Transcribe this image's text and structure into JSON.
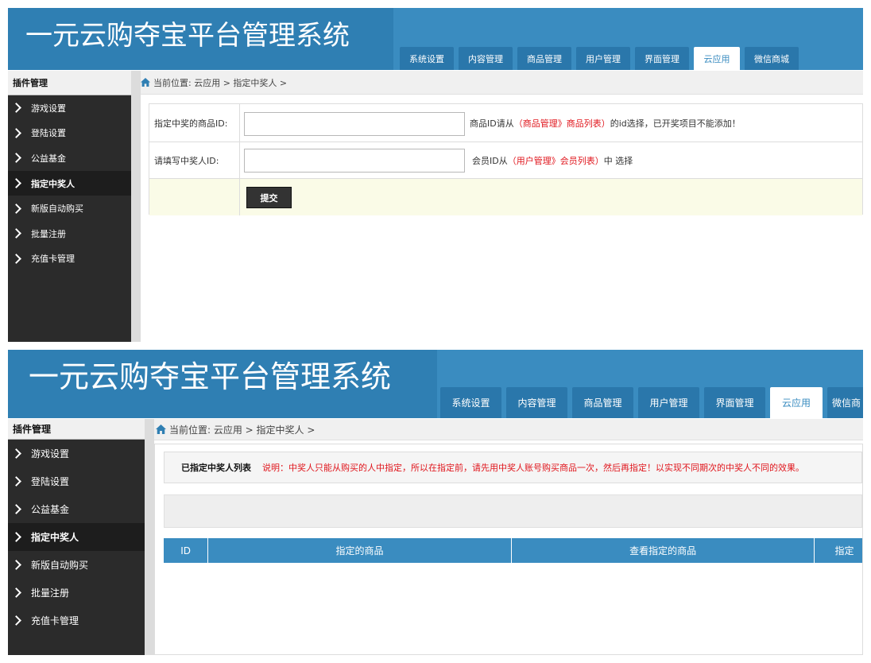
{
  "header": {
    "title": "一元云购夺宝平台管理系统",
    "tabs": [
      {
        "label": "系统设置",
        "active": false
      },
      {
        "label": "内容管理",
        "active": false
      },
      {
        "label": "商品管理",
        "active": false
      },
      {
        "label": "用户管理",
        "active": false
      },
      {
        "label": "界面管理",
        "active": false
      },
      {
        "label": "云应用",
        "active": true
      },
      {
        "label": "微信商城",
        "active": false
      }
    ],
    "tabs_clipped": [
      {
        "label": "系统设置",
        "active": false
      },
      {
        "label": "内容管理",
        "active": false
      },
      {
        "label": "商品管理",
        "active": false
      },
      {
        "label": "用户管理",
        "active": false
      },
      {
        "label": "界面管理",
        "active": false
      },
      {
        "label": "云应用",
        "active": true
      },
      {
        "label": "微信商",
        "active": false
      }
    ]
  },
  "sidebar": {
    "title": "插件管理",
    "items": [
      {
        "label": "游戏设置",
        "active": false
      },
      {
        "label": "登陆设置",
        "active": false
      },
      {
        "label": "公益基金",
        "active": false
      },
      {
        "label": "指定中奖人",
        "active": true
      },
      {
        "label": "新版自动购买",
        "active": false
      },
      {
        "label": "批量注册",
        "active": false
      },
      {
        "label": "充值卡管理",
        "active": false
      }
    ]
  },
  "breadcrumb": {
    "text": "当前位置: 云应用 > 指定中奖人 >"
  },
  "form": {
    "goods_label": "指定中奖的商品ID:",
    "goods_value": "",
    "goods_hint_prefix": "商品ID请从",
    "goods_hint_link": "（商品管理》商品列表）",
    "goods_hint_suffix": "的id选择，已开奖项目不能添加！",
    "member_label": "请填写中奖人ID:",
    "member_value": "",
    "member_hint_prefix": "会员ID从",
    "member_hint_link": "（用户管理》会员列表）",
    "member_hint_suffix": "中 选择",
    "submit_label": "提交"
  },
  "winner_list": {
    "title": "已指定中奖人列表",
    "notice": "说明：中奖人只能从购买的人中指定，所以在指定前，请先用中奖人账号购买商品一次，然后再指定！以实现不同期次的中奖人不同的效果。",
    "columns": [
      "ID",
      "指定的商品",
      "查看指定的商品",
      "指定"
    ]
  },
  "colors": {
    "header_blue": "#3a8cc0",
    "brand_blue": "#2f7fb3",
    "tab_blue": "#2a77ab",
    "sidebar_dark": "#2b2b2b",
    "alert_red": "#e0161d"
  }
}
